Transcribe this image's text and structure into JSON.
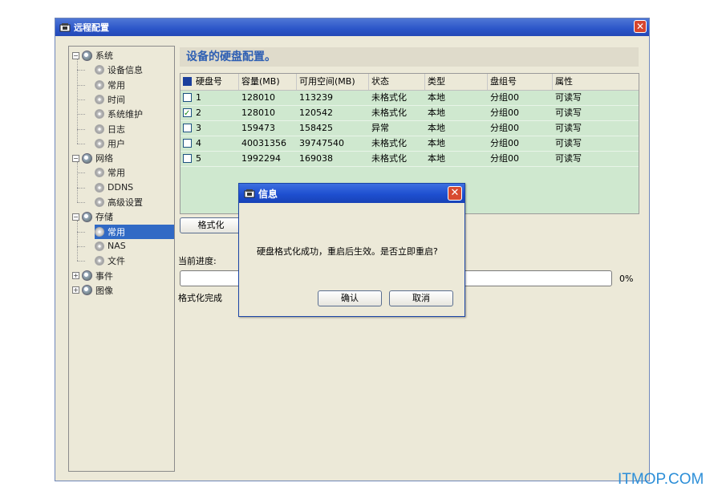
{
  "window": {
    "title": "远程配置"
  },
  "tree": {
    "items": [
      {
        "label": "系统",
        "level": 0,
        "expanded": true
      },
      {
        "label": "设备信息",
        "level": 1
      },
      {
        "label": "常用",
        "level": 1
      },
      {
        "label": "时间",
        "level": 1
      },
      {
        "label": "系统维护",
        "level": 1
      },
      {
        "label": "日志",
        "level": 1
      },
      {
        "label": "用户",
        "level": 1
      },
      {
        "label": "网络",
        "level": 0,
        "expanded": true
      },
      {
        "label": "常用",
        "level": 1
      },
      {
        "label": "DDNS",
        "level": 1
      },
      {
        "label": "高级设置",
        "level": 1
      },
      {
        "label": "存储",
        "level": 0,
        "expanded": true
      },
      {
        "label": "常用",
        "level": 1,
        "selected": true
      },
      {
        "label": "NAS",
        "level": 1
      },
      {
        "label": "文件",
        "level": 1
      },
      {
        "label": "事件",
        "level": 0,
        "expanded": false
      },
      {
        "label": "图像",
        "level": 0,
        "expanded": false
      }
    ]
  },
  "main": {
    "section_title": "设备的硬盘配置。",
    "columns": [
      "硬盘号",
      "容量(MB)",
      "可用空间(MB)",
      "状态",
      "类型",
      "盘组号",
      "属性"
    ],
    "rows": [
      {
        "checked": false,
        "cells": [
          "1",
          "128010",
          "113239",
          "未格式化",
          "本地",
          "分组00",
          "可读写"
        ]
      },
      {
        "checked": true,
        "cells": [
          "2",
          "128010",
          "120542",
          "未格式化",
          "本地",
          "分组00",
          "可读写"
        ]
      },
      {
        "checked": false,
        "cells": [
          "3",
          "159473",
          "158425",
          "异常",
          "本地",
          "分组00",
          "可读写"
        ]
      },
      {
        "checked": false,
        "cells": [
          "4",
          "40031356",
          "39747540",
          "未格式化",
          "本地",
          "分组00",
          "可读写"
        ]
      },
      {
        "checked": false,
        "cells": [
          "5",
          "1992294",
          "169038",
          "未格式化",
          "本地",
          "分组00",
          "可读写"
        ]
      }
    ],
    "format_button": "格式化",
    "progress_label": "当前进度:",
    "progress_percent_text": "0%",
    "progress_value": 0,
    "status_text": "格式化完成"
  },
  "dialog": {
    "title": "信息",
    "message": "硬盘格式化成功，重启后生效。是否立即重启?",
    "ok_label": "确认",
    "cancel_label": "取消"
  },
  "watermark": "ITMOP.COM",
  "colors": {
    "titlebar_blue": "#2b55c8",
    "row_green": "#cfe8cf",
    "selection_blue": "#316ac5",
    "accent_text_blue": "#2e5fb3",
    "close_red": "#d6452d",
    "watermark_blue": "#2d8fd8"
  },
  "icons": {
    "app": "app-window-icon",
    "tree_parent": "gear-cluster-icon",
    "tree_leaf": "gear-leaf-icon",
    "close": "close-icon",
    "checkbox_checked": "checkmark-icon"
  }
}
